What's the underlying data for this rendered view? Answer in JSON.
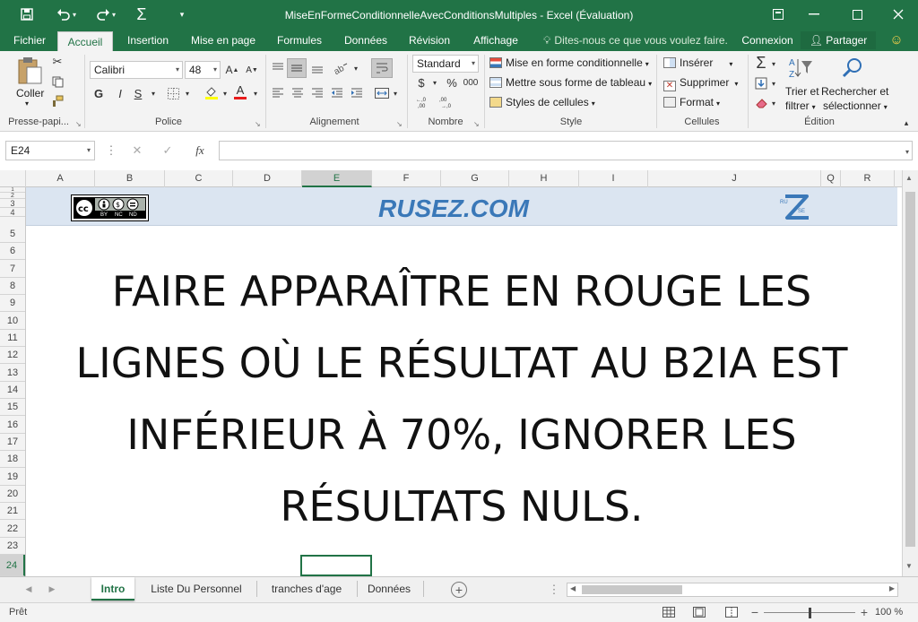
{
  "titlebar": {
    "title": "MiseEnFormeConditionnelleAvecConditionsMultiples - Excel (Évaluation)",
    "save_icon": "save-icon",
    "undo_icon": "undo-icon",
    "redo_icon": "redo-icon",
    "sum_icon": "autosum-icon"
  },
  "tabs": {
    "file": "Fichier",
    "home": "Accueil",
    "insert": "Insertion",
    "layout": "Mise en page",
    "formulas": "Formules",
    "data": "Données",
    "review": "Révision",
    "view": "Affichage",
    "tell": "Dites-nous ce que vous voulez faire.",
    "login": "Connexion",
    "share": "Partager"
  },
  "ribbon": {
    "clipboard": {
      "paste": "Coller",
      "label": "Presse-papi..."
    },
    "font": {
      "name": "Calibri",
      "size": "48",
      "bold": "G",
      "italic": "I",
      "underline": "S",
      "label": "Police"
    },
    "alignment": {
      "label": "Alignement"
    },
    "number": {
      "format": "Standard",
      "currency": "$",
      "percent": "%",
      "thousands": "000",
      "label": "Nombre"
    },
    "style": {
      "conditional": "Mise en forme conditionnelle",
      "table": "Mettre sous forme de tableau",
      "cell_styles": "Styles de cellules",
      "label": "Style"
    },
    "cells": {
      "insert": "Insérer",
      "delete": "Supprimer",
      "format": "Format",
      "label": "Cellules"
    },
    "editing": {
      "sort_line1": "Trier et",
      "sort_line2": "filtrer",
      "find_line1": "Rechercher et",
      "find_line2": "sélectionner",
      "label": "Édition"
    }
  },
  "formula_bar": {
    "namebox": "E24",
    "fx": "fx",
    "formula": ""
  },
  "columns": [
    "A",
    "B",
    "C",
    "D",
    "E",
    "F",
    "G",
    "H",
    "I",
    "J",
    "Q",
    "R"
  ],
  "rows": [
    "1",
    "2",
    "3",
    "4",
    "5",
    "6",
    "7",
    "8",
    "9",
    "10",
    "11",
    "12",
    "13",
    "14",
    "15",
    "16",
    "17",
    "18",
    "19",
    "20",
    "21",
    "22",
    "23",
    "24"
  ],
  "sheet": {
    "site": "RUSEZ.COM",
    "cc_labels": [
      "BY",
      "NC",
      "ND"
    ],
    "headline": "FAIRE APPARAÎTRE EN ROUGE LES LIGNES OÙ LE RÉSULTAT AU B2IA EST INFÉRIEUR À 70%, IGNORER LES RÉSULTATS NULS.",
    "headline_lines": [
      "FAIRE APPARAÎTRE EN ROUGE LES",
      "LIGNES OÙ LE RÉSULTAT AU B2IA EST",
      "INFÉRIEUR À 70%, IGNORER LES",
      "RÉSULTATS NULS."
    ],
    "zlogo_small1": "RU",
    "zlogo_small2": "SE",
    "zlogo_big": "Z"
  },
  "sheet_tabs": [
    "Intro",
    "Liste Du Personnel",
    "tranches d'age",
    "Données"
  ],
  "status": {
    "ready": "Prêt",
    "zoom": "100 %",
    "zoom_level": 1.0
  },
  "colors": {
    "excel_green": "#217346",
    "banner": "#dbe5f1",
    "site_blue": "#3a78b8"
  }
}
